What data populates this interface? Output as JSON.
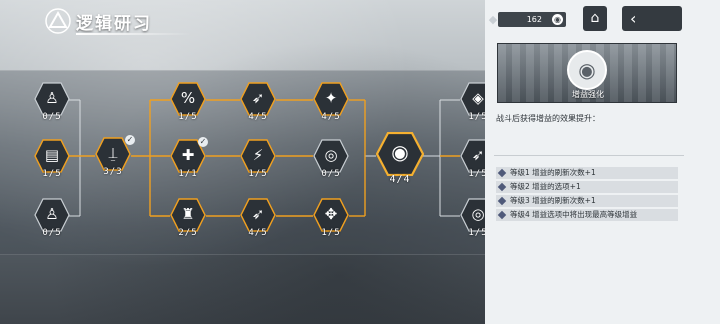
{
  "header": {
    "title": "逻辑研习",
    "logo_icon": "triangle-logo-icon"
  },
  "topbar": {
    "resource_value": "162",
    "resource_icon": "chip-icon",
    "home_icon": "⌂",
    "back_icon": "‹"
  },
  "tree": {
    "col0": [
      {
        "glyph": "♙",
        "level": "0/5",
        "icon": "figure-icon"
      },
      {
        "glyph": "▤",
        "level": "1/5",
        "icon": "cards-icon"
      },
      {
        "glyph": "♙",
        "level": "0/5",
        "icon": "figure-icon"
      }
    ],
    "col1": [
      {
        "glyph": "⍊",
        "level": "3/3",
        "icon": "signal-tower-icon"
      }
    ],
    "col2": [
      {
        "glyph": "%",
        "level": "1/5",
        "icon": "percent-icon"
      },
      {
        "glyph": "✚",
        "level": "1/1",
        "icon": "heart-plus-icon"
      },
      {
        "glyph": "♜",
        "level": "2/5",
        "icon": "boot-icon"
      }
    ],
    "col3": [
      {
        "glyph": "➶",
        "level": "4/5",
        "icon": "rifle-icon"
      },
      {
        "glyph": "⚡",
        "level": "1/5",
        "icon": "lightning-icon"
      },
      {
        "glyph": "➶",
        "level": "4/5",
        "icon": "rifle-icon"
      }
    ],
    "col4": [
      {
        "glyph": "✦",
        "level": "4/5",
        "icon": "compass-star-icon"
      },
      {
        "glyph": "◎",
        "level": "0/5",
        "icon": "broadcast-icon"
      },
      {
        "glyph": "✥",
        "level": "1/5",
        "icon": "axes-icon"
      }
    ],
    "col5": [
      {
        "glyph": "◉",
        "level": "4/4",
        "icon": "coins-icon"
      }
    ],
    "col6": [
      {
        "glyph": "◈",
        "level": "1/5",
        "icon": "diamond-target-icon"
      },
      {
        "glyph": "➶",
        "level": "1/5",
        "icon": "rifle-icon"
      },
      {
        "glyph": "◎",
        "level": "1/5",
        "icon": "ring-target-icon"
      }
    ]
  },
  "panel": {
    "skill_name": "增益强化",
    "skill_icon": "coins-icon",
    "description": "战斗后获得增益的效果提升：",
    "effects": [
      "等级1 增益的刷新次数+1",
      "等级2 增益的选项+1",
      "等级3 增益的刷新次数+1",
      "等级4 增益选项中将出现最高等级增益"
    ]
  },
  "colors": {
    "active_line": "#f0a020",
    "inactive_line": "#d8dde1",
    "panel_bg": "#eef1f3",
    "bullet_bg": "#d9dde1"
  }
}
